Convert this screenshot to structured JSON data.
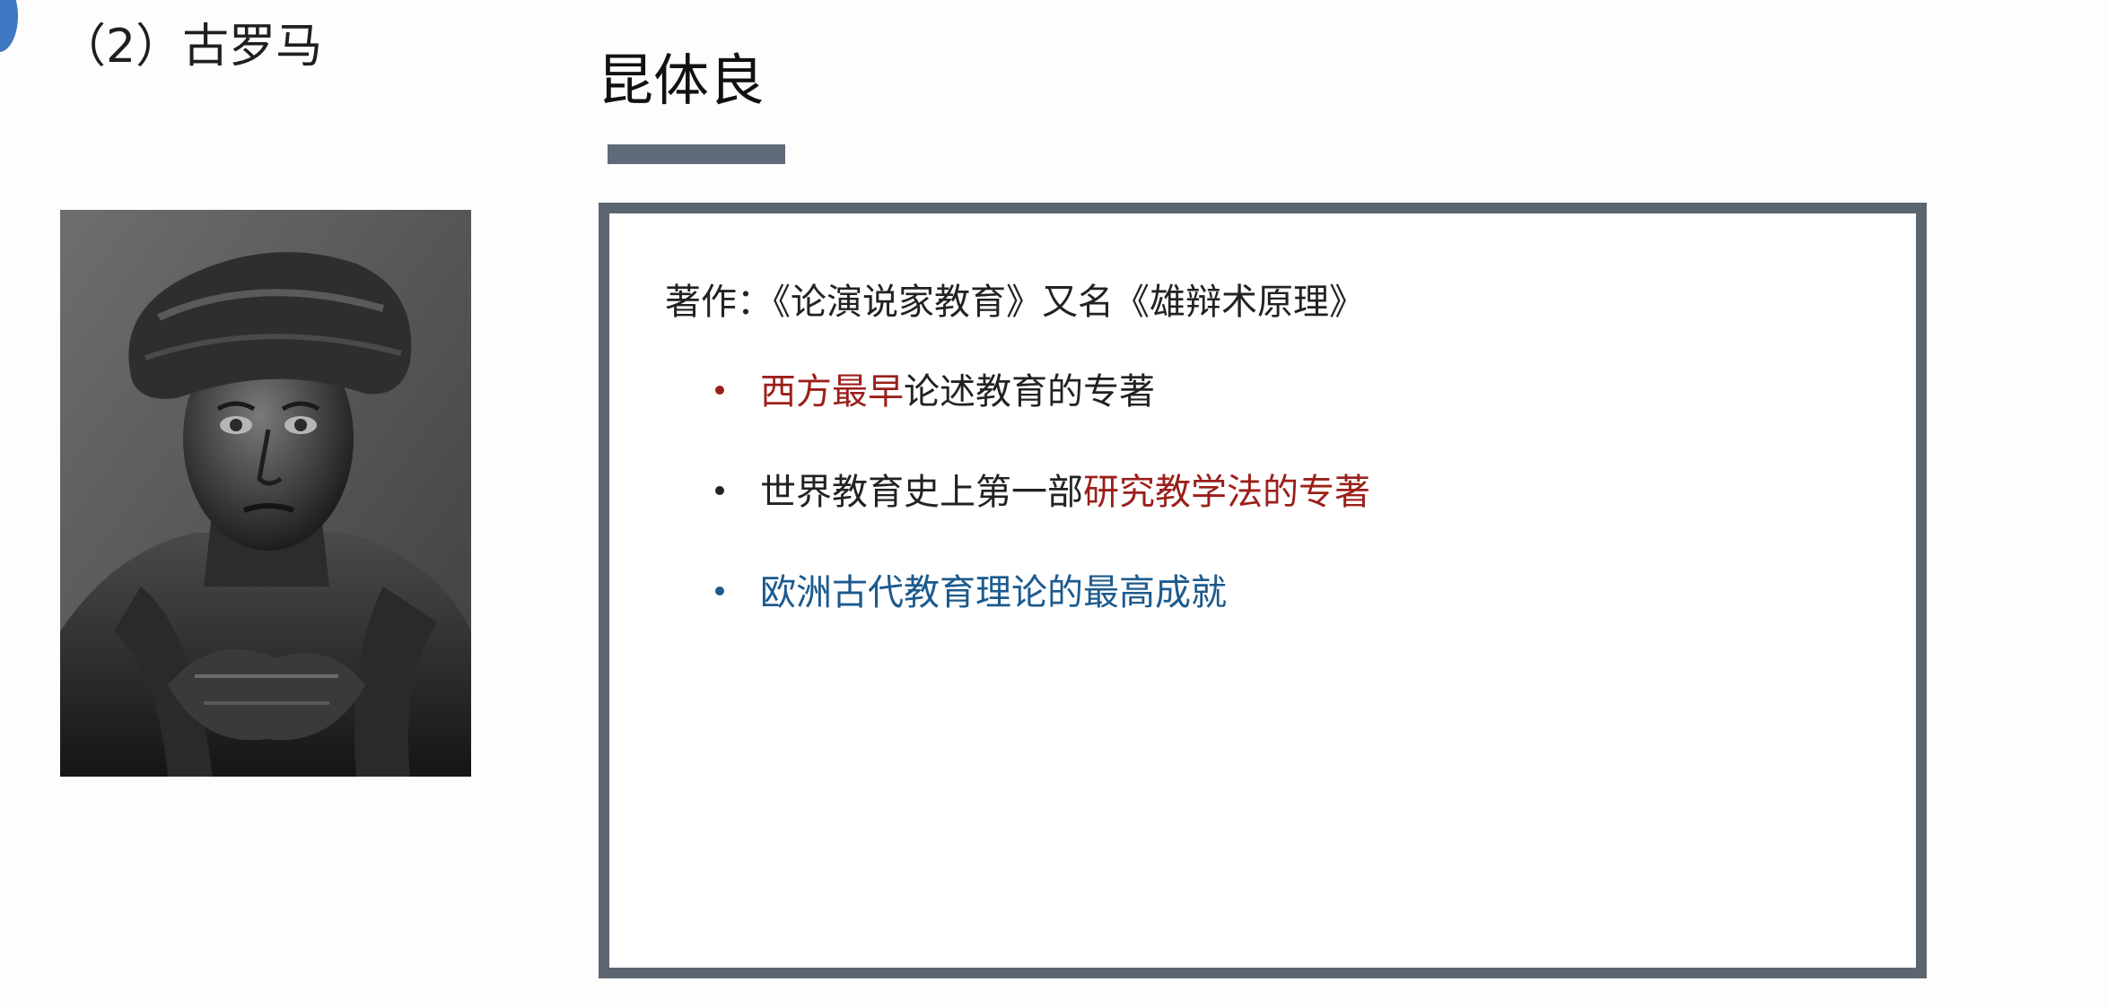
{
  "colors": {
    "accent_red": "#9b1f1a",
    "accent_blue": "#1c5a8e",
    "text_dark": "#222222",
    "box_border": "#5b6570",
    "corner_accent": "#3e78c2"
  },
  "slide": {
    "section_heading": "（2）古罗马",
    "person_title": "昆体良",
    "portrait": {
      "icon": "bronze-bust-portrait"
    },
    "works_line": "著作：《论演说家教育》又名《雄辩术原理》",
    "bullets": [
      {
        "bullet_color": "#9b1f1a",
        "highlight": "西方最早",
        "rest": "论述教育的专著"
      },
      {
        "bullet_color": "#222222",
        "lead": "世界教育史上第一部",
        "highlight": "研究教学法的专著"
      },
      {
        "bullet_color": "#1c5a8e",
        "text": "欧洲古代教育理论的最高成就"
      }
    ]
  }
}
